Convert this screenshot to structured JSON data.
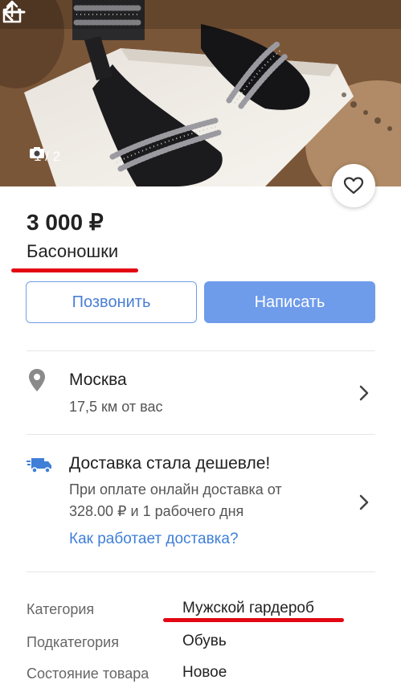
{
  "photo": {
    "counter": "1 / 2"
  },
  "listing": {
    "price": "3 000 ₽",
    "title": "Басоношки"
  },
  "actions": {
    "call_label": "Позвонить",
    "write_label": "Написать"
  },
  "location": {
    "city": "Москва",
    "distance": "17,5 км от вас"
  },
  "delivery": {
    "title": "Доставка стала дешевле!",
    "line1": "При оплате онлайн доставка от",
    "line2": "328.00 ₽ и 1 рабочего дня",
    "link": "Как работает доставка?"
  },
  "properties": [
    {
      "label": "Категория",
      "value": "Мужской гардероб"
    },
    {
      "label": "Подкатегория",
      "value": "Обувь"
    },
    {
      "label": "Состояние товара",
      "value": "Новое"
    }
  ],
  "colors": {
    "accent": "#6e9bea",
    "link": "#3f7fd8",
    "annotation_red": "#e30613"
  },
  "icons": [
    "back-arrow-icon",
    "share-icon",
    "camera-icon",
    "heart-icon",
    "location-pin-icon",
    "delivery-truck-icon",
    "chevron-right-icon"
  ]
}
